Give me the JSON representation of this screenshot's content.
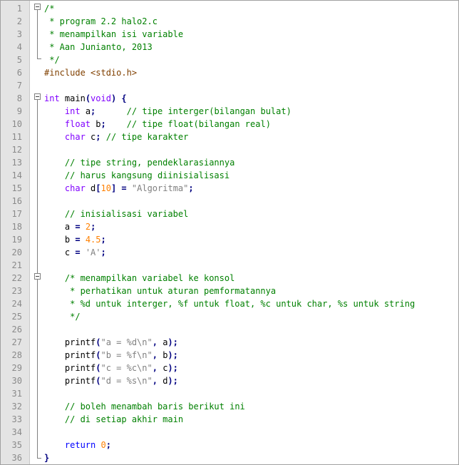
{
  "line_numbers": [
    "1",
    "2",
    "3",
    "4",
    "5",
    "6",
    "7",
    "8",
    "9",
    "10",
    "11",
    "12",
    "13",
    "14",
    "15",
    "16",
    "17",
    "18",
    "19",
    "20",
    "21",
    "22",
    "23",
    "24",
    "25",
    "26",
    "27",
    "28",
    "29",
    "30",
    "31",
    "32",
    "33",
    "34",
    "35",
    "36"
  ],
  "lines": [
    [
      {
        "t": "/*",
        "c": "cm"
      }
    ],
    [
      {
        "t": " * program 2.2 halo2.c",
        "c": "cm"
      }
    ],
    [
      {
        "t": " * menampilkan isi variable",
        "c": "cm"
      }
    ],
    [
      {
        "t": " * Aan Junianto, 2013",
        "c": "cm"
      }
    ],
    [
      {
        "t": " */",
        "c": "cm"
      }
    ],
    [
      {
        "t": "#include <stdio.h>",
        "c": "pp"
      }
    ],
    [],
    [
      {
        "t": "int",
        "c": "ty"
      },
      {
        "t": " main",
        "c": ""
      },
      {
        "t": "(",
        "c": "op"
      },
      {
        "t": "void",
        "c": "ty"
      },
      {
        "t": ")",
        "c": "op"
      },
      {
        "t": " ",
        "c": ""
      },
      {
        "t": "{",
        "c": "op"
      }
    ],
    [
      {
        "t": "    ",
        "c": ""
      },
      {
        "t": "int",
        "c": "ty"
      },
      {
        "t": " a",
        "c": ""
      },
      {
        "t": ";",
        "c": "op"
      },
      {
        "t": "      ",
        "c": ""
      },
      {
        "t": "// tipe interger(bilangan bulat)",
        "c": "cm"
      }
    ],
    [
      {
        "t": "    ",
        "c": ""
      },
      {
        "t": "float",
        "c": "ty"
      },
      {
        "t": " b",
        "c": ""
      },
      {
        "t": ";",
        "c": "op"
      },
      {
        "t": "    ",
        "c": ""
      },
      {
        "t": "// tipe float(bilangan real)",
        "c": "cm"
      }
    ],
    [
      {
        "t": "    ",
        "c": ""
      },
      {
        "t": "char",
        "c": "ty"
      },
      {
        "t": " c",
        "c": ""
      },
      {
        "t": ";",
        "c": "op"
      },
      {
        "t": " ",
        "c": ""
      },
      {
        "t": "// tipe karakter",
        "c": "cm"
      }
    ],
    [],
    [
      {
        "t": "    ",
        "c": ""
      },
      {
        "t": "// tipe string, pendeklarasiannya",
        "c": "cm"
      }
    ],
    [
      {
        "t": "    ",
        "c": ""
      },
      {
        "t": "// harus kangsung diinisialisasi",
        "c": "cm"
      }
    ],
    [
      {
        "t": "    ",
        "c": ""
      },
      {
        "t": "char",
        "c": "ty"
      },
      {
        "t": " d",
        "c": ""
      },
      {
        "t": "[",
        "c": "op"
      },
      {
        "t": "10",
        "c": "num"
      },
      {
        "t": "]",
        "c": "op"
      },
      {
        "t": " ",
        "c": ""
      },
      {
        "t": "=",
        "c": "op"
      },
      {
        "t": " ",
        "c": ""
      },
      {
        "t": "\"Algoritma\"",
        "c": "str"
      },
      {
        "t": ";",
        "c": "op"
      }
    ],
    [],
    [
      {
        "t": "    ",
        "c": ""
      },
      {
        "t": "// inisialisasi variabel",
        "c": "cm"
      }
    ],
    [
      {
        "t": "    a ",
        "c": ""
      },
      {
        "t": "=",
        "c": "op"
      },
      {
        "t": " ",
        "c": ""
      },
      {
        "t": "2",
        "c": "num"
      },
      {
        "t": ";",
        "c": "op"
      }
    ],
    [
      {
        "t": "    b ",
        "c": ""
      },
      {
        "t": "=",
        "c": "op"
      },
      {
        "t": " ",
        "c": ""
      },
      {
        "t": "4.5",
        "c": "num"
      },
      {
        "t": ";",
        "c": "op"
      }
    ],
    [
      {
        "t": "    c ",
        "c": ""
      },
      {
        "t": "=",
        "c": "op"
      },
      {
        "t": " ",
        "c": ""
      },
      {
        "t": "'A'",
        "c": "str"
      },
      {
        "t": ";",
        "c": "op"
      }
    ],
    [],
    [
      {
        "t": "    ",
        "c": ""
      },
      {
        "t": "/* menampilkan variabel ke konsol",
        "c": "cm"
      }
    ],
    [
      {
        "t": "     * perhatikan untuk aturan pemformatannya",
        "c": "cm"
      }
    ],
    [
      {
        "t": "     * %d untuk interger, %f untuk float, %c untuk char, %s untuk string",
        "c": "cm"
      }
    ],
    [
      {
        "t": "     */",
        "c": "cm"
      }
    ],
    [],
    [
      {
        "t": "    printf",
        "c": ""
      },
      {
        "t": "(",
        "c": "op"
      },
      {
        "t": "\"a = %d\\n\"",
        "c": "str"
      },
      {
        "t": ",",
        "c": "op"
      },
      {
        "t": " a",
        "c": ""
      },
      {
        "t": ");",
        "c": "op"
      }
    ],
    [
      {
        "t": "    printf",
        "c": ""
      },
      {
        "t": "(",
        "c": "op"
      },
      {
        "t": "\"b = %f\\n\"",
        "c": "str"
      },
      {
        "t": ",",
        "c": "op"
      },
      {
        "t": " b",
        "c": ""
      },
      {
        "t": ");",
        "c": "op"
      }
    ],
    [
      {
        "t": "    printf",
        "c": ""
      },
      {
        "t": "(",
        "c": "op"
      },
      {
        "t": "\"c = %c\\n\"",
        "c": "str"
      },
      {
        "t": ",",
        "c": "op"
      },
      {
        "t": " c",
        "c": ""
      },
      {
        "t": ");",
        "c": "op"
      }
    ],
    [
      {
        "t": "    printf",
        "c": ""
      },
      {
        "t": "(",
        "c": "op"
      },
      {
        "t": "\"d = %s\\n\"",
        "c": "str"
      },
      {
        "t": ",",
        "c": "op"
      },
      {
        "t": " d",
        "c": ""
      },
      {
        "t": ");",
        "c": "op"
      }
    ],
    [],
    [
      {
        "t": "    ",
        "c": ""
      },
      {
        "t": "// boleh menambah baris berikut ini",
        "c": "cm"
      }
    ],
    [
      {
        "t": "    ",
        "c": ""
      },
      {
        "t": "// di setiap akhir main",
        "c": "cm"
      }
    ],
    [],
    [
      {
        "t": "    ",
        "c": ""
      },
      {
        "t": "return",
        "c": "kw"
      },
      {
        "t": " ",
        "c": ""
      },
      {
        "t": "0",
        "c": "num"
      },
      {
        "t": ";",
        "c": "op"
      }
    ],
    [
      {
        "t": "}",
        "c": "op"
      }
    ]
  ],
  "colors": {
    "comment": "#008000",
    "keyword": "#0000ff",
    "type": "#8000ff",
    "number": "#ff8000",
    "string": "#808080",
    "preprocessor": "#804000",
    "operator": "#000080"
  }
}
